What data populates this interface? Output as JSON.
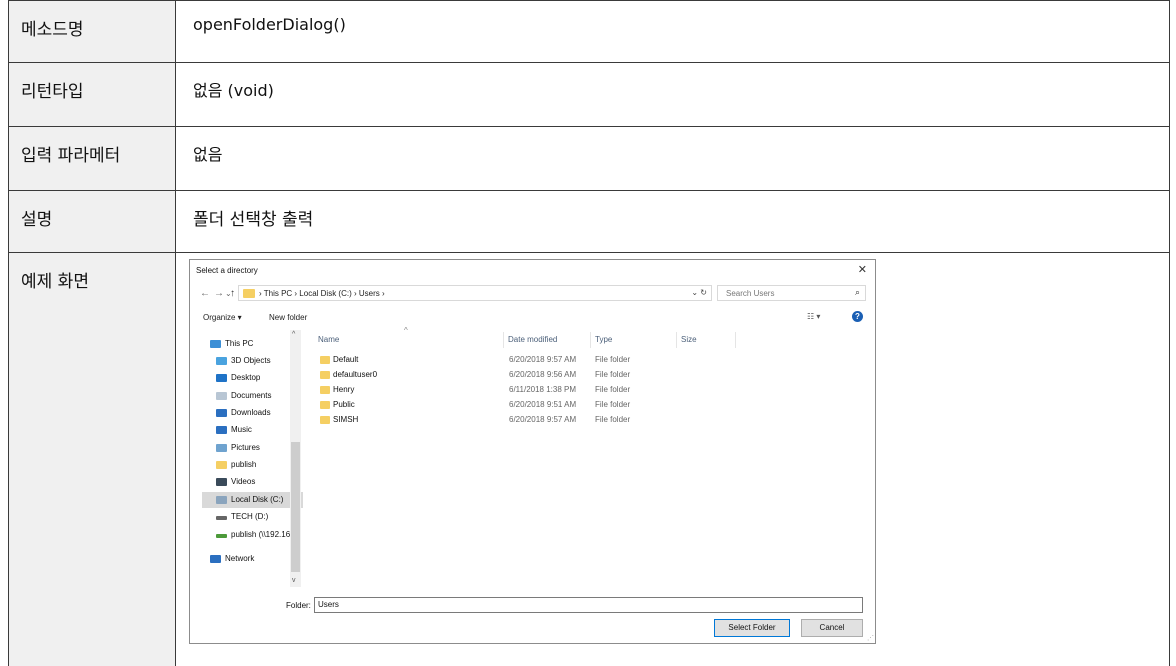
{
  "rows": [
    {
      "label": "메소드명",
      "value": "openFolderDialog()"
    },
    {
      "label": "리턴타입",
      "value": "없음 (void)"
    },
    {
      "label": "입력 파라메터",
      "value": "없음"
    },
    {
      "label": "설명",
      "value": "폴더 선택창 출력"
    },
    {
      "label": "예제 화면",
      "value": ""
    }
  ],
  "dialog": {
    "title": "Select a directory",
    "close": "✕",
    "nav": {
      "back": "←",
      "forward": "→",
      "recent": "⌄",
      "up": "↑"
    },
    "path": "› This PC › Local Disk (C:) › Users ›",
    "path_tools": "⌄ ↻",
    "search_placeholder": "Search Users",
    "toolbar": {
      "organize": "Organize ▾",
      "new_folder": "New folder",
      "view": "☷ ▾",
      "help": "?"
    },
    "nav_items": [
      {
        "label": "This PC",
        "icon": "computer-icon",
        "color": "#3c8fd6"
      },
      {
        "label": "3D Objects",
        "icon": "cube-icon",
        "color": "#4aa3df"
      },
      {
        "label": "Desktop",
        "icon": "desktop-icon",
        "color": "#1f73c7"
      },
      {
        "label": "Documents",
        "icon": "document-icon",
        "color": "#b8c6d4"
      },
      {
        "label": "Downloads",
        "icon": "download-icon",
        "color": "#2b6fc0"
      },
      {
        "label": "Music",
        "icon": "music-icon",
        "color": "#2b6fc0"
      },
      {
        "label": "Pictures",
        "icon": "picture-icon",
        "color": "#6fa3cf"
      },
      {
        "label": "publish",
        "icon": "folder-icon",
        "color": "#f5cf63"
      },
      {
        "label": "Videos",
        "icon": "video-icon",
        "color": "#3a4a5a"
      },
      {
        "label": "Local Disk (C:)",
        "icon": "disk-icon",
        "color": "#8aa4bd",
        "selected": true
      },
      {
        "label": "TECH (D:)",
        "icon": "drive-icon",
        "color": "#666666"
      },
      {
        "label": "publish (\\\\192.16",
        "icon": "network-drive-icon",
        "color": "#4c9a3a"
      },
      {
        "label": "Network",
        "icon": "network-icon",
        "color": "#2b6fc0"
      }
    ],
    "columns": {
      "name": "Name",
      "date": "Date modified",
      "type": "Type",
      "size": "Size"
    },
    "files": [
      {
        "name": "Default",
        "date": "6/20/2018 9:57 AM",
        "type": "File folder"
      },
      {
        "name": "defaultuser0",
        "date": "6/20/2018 9:56 AM",
        "type": "File folder"
      },
      {
        "name": "Henry",
        "date": "6/11/2018 1:38 PM",
        "type": "File folder"
      },
      {
        "name": "Public",
        "date": "6/20/2018 9:51 AM",
        "type": "File folder"
      },
      {
        "name": "SIMSH",
        "date": "6/20/2018 9:57 AM",
        "type": "File folder"
      }
    ],
    "folder_label": "Folder:",
    "folder_value": "Users",
    "buttons": {
      "select": "Select Folder",
      "cancel": "Cancel"
    }
  }
}
